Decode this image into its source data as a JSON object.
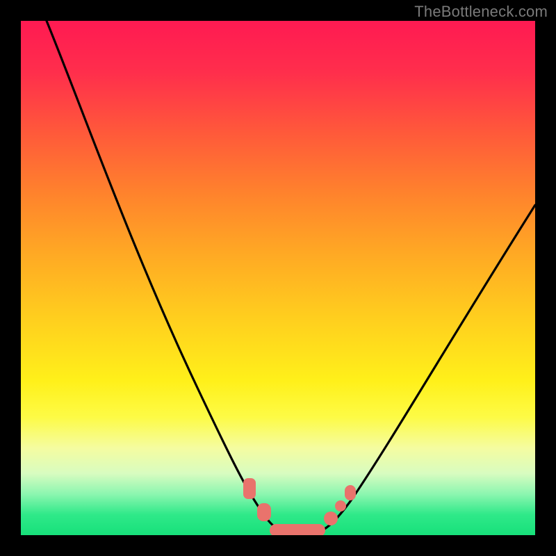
{
  "watermark": "TheBottleneck.com",
  "chart_data": {
    "type": "line",
    "title": "",
    "xlabel": "",
    "ylabel": "",
    "xlim": [
      0,
      100
    ],
    "ylim": [
      0,
      100
    ],
    "series": [
      {
        "name": "bottleneck-curve",
        "x": [
          5,
          10,
          15,
          20,
          25,
          30,
          35,
          40,
          45,
          48,
          50,
          52,
          55,
          58,
          60,
          65,
          70,
          75,
          80,
          85,
          90,
          95,
          100
        ],
        "y": [
          100,
          88,
          76,
          64,
          52,
          40,
          28,
          17,
          7,
          2,
          0,
          0,
          0,
          2,
          5,
          12,
          20,
          28,
          36,
          44,
          52,
          60,
          68
        ]
      }
    ],
    "markers": [
      {
        "name": "left-marker-1",
        "x": 44,
        "y": 9,
        "shape": "round-rect"
      },
      {
        "name": "left-marker-2",
        "x": 44,
        "y": 7,
        "shape": "round-rect"
      },
      {
        "name": "left-marker-3",
        "x": 47,
        "y": 3,
        "shape": "round-rect"
      },
      {
        "name": "bottom-marker",
        "x": 53,
        "y": 0,
        "shape": "wide-round-rect"
      },
      {
        "name": "right-marker-1",
        "x": 59,
        "y": 3,
        "shape": "dot"
      },
      {
        "name": "right-marker-2",
        "x": 61,
        "y": 6,
        "shape": "dot"
      },
      {
        "name": "right-marker-3",
        "x": 63,
        "y": 9,
        "shape": "dot"
      }
    ],
    "colors": {
      "curve": "#000000",
      "marker": "#e9736c",
      "gradient_top": "#ff1a52",
      "gradient_bottom": "#17e07a"
    }
  }
}
